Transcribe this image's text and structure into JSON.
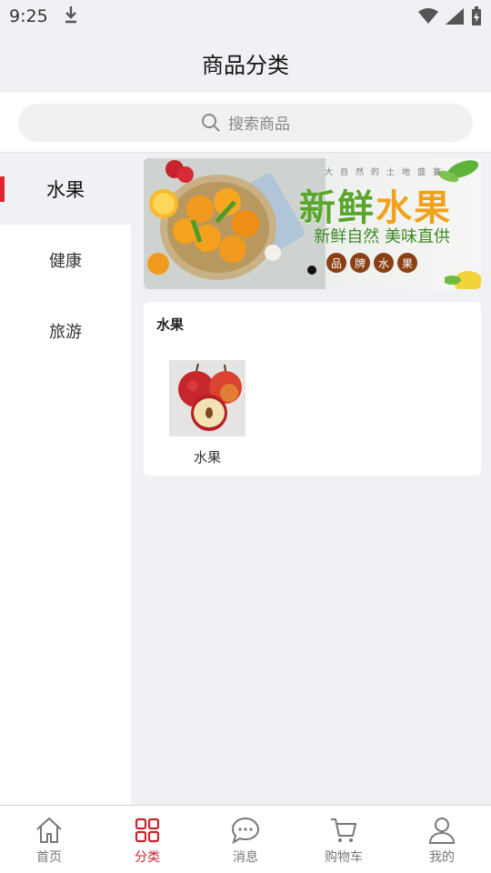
{
  "status_bar": {
    "time": "9:25"
  },
  "header": {
    "title": "商品分类"
  },
  "search": {
    "placeholder": "搜索商品"
  },
  "sidebar": {
    "items": [
      {
        "label": "水果",
        "active": true
      },
      {
        "label": "健康",
        "active": false
      },
      {
        "label": "旅游",
        "active": false
      }
    ]
  },
  "banner": {
    "small_text": "大自然的土地盛宴",
    "title_a": "新鲜",
    "title_b": "水果",
    "subtitle": "新鲜自然 美味直供",
    "tag": [
      "品",
      "牌",
      "水",
      "果"
    ]
  },
  "section": {
    "title": "水果",
    "products": [
      {
        "label": "水果"
      }
    ]
  },
  "tabbar": {
    "items": [
      {
        "label": "首页",
        "icon": "home-icon"
      },
      {
        "label": "分类",
        "icon": "grid-icon",
        "active": true
      },
      {
        "label": "消息",
        "icon": "chat-icon"
      },
      {
        "label": "购物车",
        "icon": "cart-icon"
      },
      {
        "label": "我的",
        "icon": "user-icon"
      }
    ]
  },
  "colors": {
    "accent": "#c9232a",
    "background": "#f0f1f5"
  }
}
